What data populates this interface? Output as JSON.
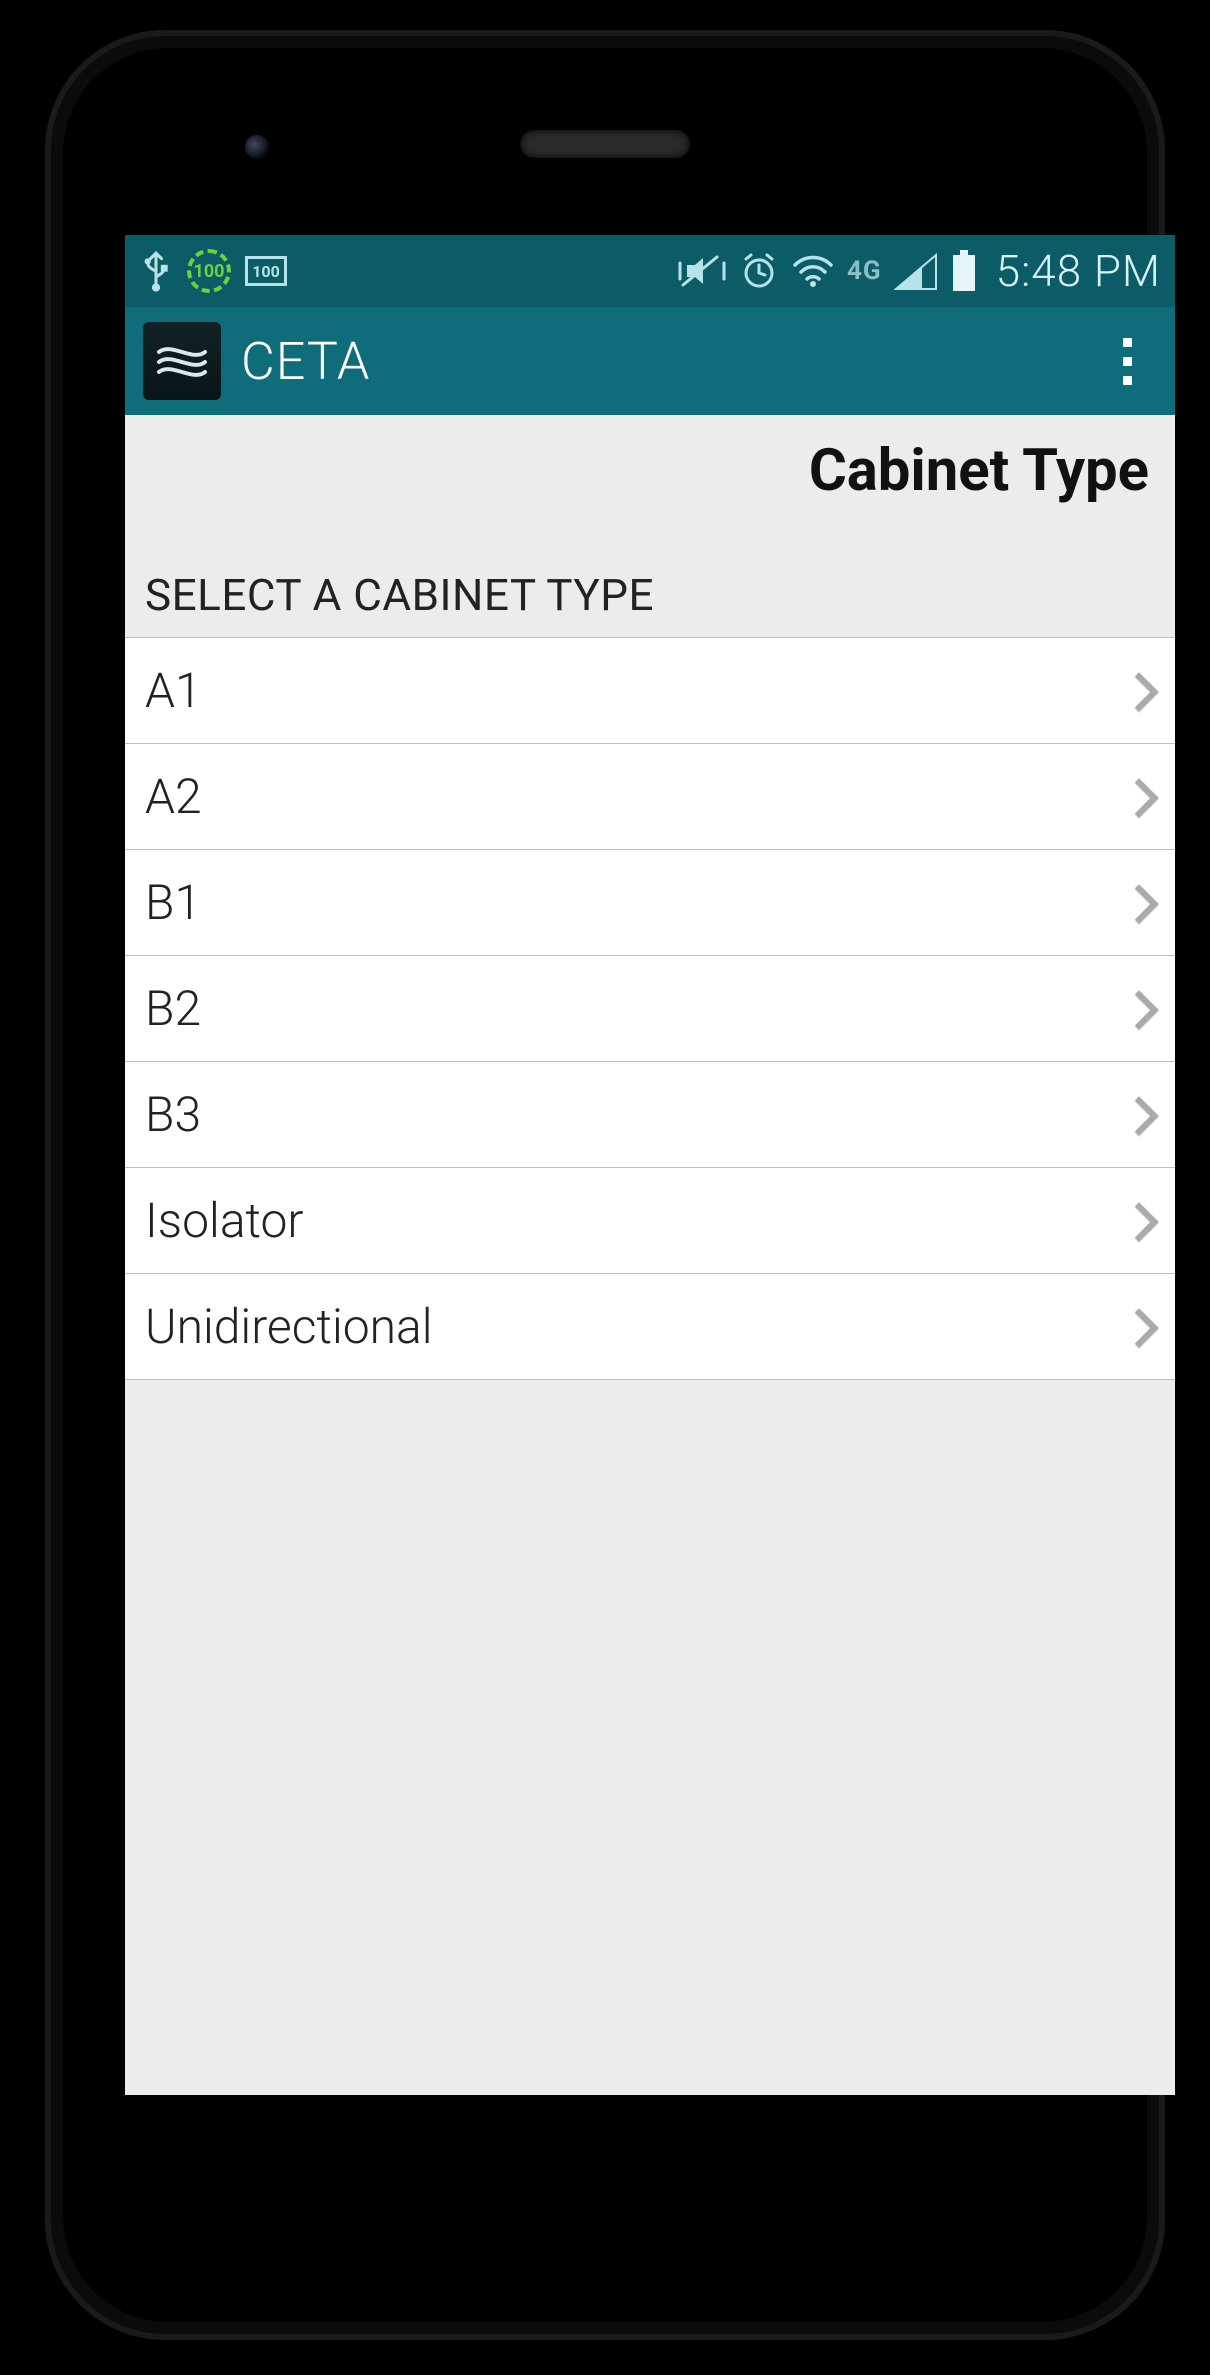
{
  "status": {
    "time": "5:48 PM",
    "lte": "4G",
    "battery_badge": "100",
    "battery_box": "100"
  },
  "app": {
    "title": "CETA"
  },
  "page": {
    "title": "Cabinet Type",
    "section_label": "SELECT A CABINET TYPE"
  },
  "list": {
    "items": [
      {
        "label": "A1"
      },
      {
        "label": "A2"
      },
      {
        "label": "B1"
      },
      {
        "label": "B2"
      },
      {
        "label": "B3"
      },
      {
        "label": "Isolator"
      },
      {
        "label": "Unidirectional"
      }
    ]
  }
}
